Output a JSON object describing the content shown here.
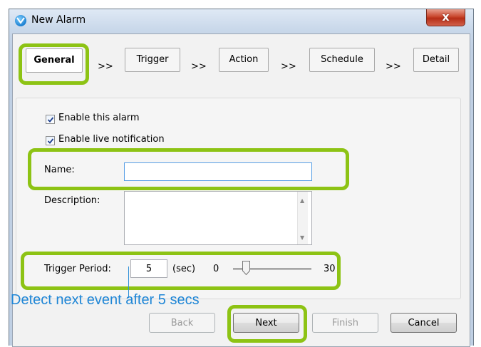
{
  "window": {
    "title": "New Alarm",
    "close_glyph": "x"
  },
  "tabs": [
    {
      "label": "General",
      "active": true
    },
    {
      "label": "Trigger",
      "active": false
    },
    {
      "label": "Action",
      "active": false
    },
    {
      "label": "Schedule",
      "active": false
    },
    {
      "label": "Detail",
      "active": false
    }
  ],
  "tab_separator": ">>",
  "general": {
    "enable_alarm": {
      "label": "Enable this alarm",
      "checked": true
    },
    "enable_notification": {
      "label": "Enable live notification",
      "checked": true
    },
    "name_label": "Name:",
    "name_value": "",
    "description_label": "Description:",
    "description_value": "",
    "trigger_period_label": "Trigger Period:",
    "trigger_period_value": "5",
    "trigger_unit": "(sec)",
    "slider_min": "0",
    "slider_max": "30",
    "slider_value": 5
  },
  "buttons": {
    "back": "Back",
    "next": "Next",
    "finish": "Finish",
    "cancel": "Cancel"
  },
  "annotation": {
    "text": "Detect next event after 5 secs"
  },
  "colors": {
    "highlight": "#8dc314",
    "annotation": "#1f86d6",
    "close": "#c9472e"
  }
}
